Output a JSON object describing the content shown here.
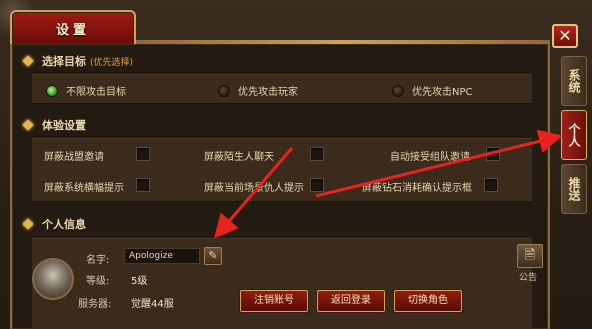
{
  "window": {
    "title": "设置",
    "close_glyph": "✕"
  },
  "side_tabs": [
    {
      "label": "系统",
      "active": false
    },
    {
      "label": "个人",
      "active": true
    },
    {
      "label": "推送",
      "active": false
    }
  ],
  "target": {
    "title": "选择目标",
    "subtitle": "(优先选择)",
    "options": [
      {
        "label": "不限攻击目标",
        "selected": true
      },
      {
        "label": "优先攻击玩家",
        "selected": false
      },
      {
        "label": "优先攻击NPC",
        "selected": false
      }
    ]
  },
  "experience": {
    "title": "体验设置",
    "options": [
      {
        "label": "屏蔽战盟邀请",
        "checked": false
      },
      {
        "label": "屏蔽陌生人聊天",
        "checked": false
      },
      {
        "label": "自动接受组队邀请",
        "checked": false
      },
      {
        "label": "屏蔽系统横幅提示",
        "checked": false
      },
      {
        "label": "屏蔽当前场景仇人提示",
        "checked": false
      },
      {
        "label": "屏蔽钻石消耗确认提示框",
        "checked": false
      }
    ]
  },
  "profile": {
    "title": "个人信息",
    "name_label": "名字:",
    "name_value": "Apologize",
    "level_label": "等级:",
    "level_value": "5级",
    "server_label": "服务器:",
    "server_value": "觉醒44服",
    "notice_label": "公告",
    "buttons": {
      "logout": "注销账号",
      "return_login": "返回登录",
      "switch_role": "切换角色"
    }
  },
  "colors": {
    "accent_red": "#a01b13",
    "gold": "#c9a463",
    "annotation_red": "#e8231d"
  }
}
